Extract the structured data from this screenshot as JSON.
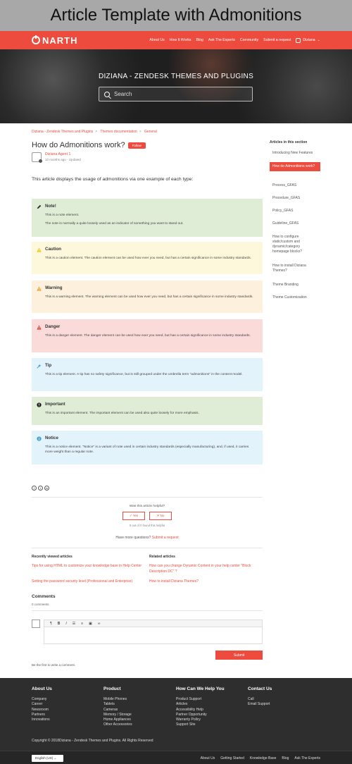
{
  "caption": "Article Template with Admonitions",
  "header": {
    "logo_text": "NARTH",
    "nav": [
      "About Us",
      "How It Works",
      "Blog",
      "Ask The Experts",
      "Community",
      "Submit a request"
    ],
    "user": "Diziana"
  },
  "hero": {
    "title": "DIZIANA - ZENDESK THEMES AND PLUGINS",
    "search_placeholder": "Search"
  },
  "breadcrumbs": [
    "Diziana - Zendesk Themes and Plugins",
    "Themes documentation",
    "General"
  ],
  "article": {
    "title": "How do Admonitions work?",
    "follow_label": "Follow",
    "author": "Diziana Agent 1",
    "meta_time": "10 months ago",
    "meta_sep": "·",
    "meta_status": "Updated",
    "intro": "This article displays the usage of admonitions via one example of each type:"
  },
  "admonitions": [
    {
      "title": "Note!",
      "p1": "This is a note element.",
      "p2": "The note is normally a quite loosely used as an indicator of something you want to stand out.",
      "color": "#dfecd6",
      "icon": "pencil-icon"
    },
    {
      "title": "Caution",
      "p1": "This is a caution element. The caution element can be used how ever you need, but has a certain significance in some industry standards.",
      "color": "#fdf8dc",
      "icon": "caution-icon"
    },
    {
      "title": "Warning",
      "p1": "This is a warning element. The warning element can be used how ever you need, but has a certain significance in some industry standards.",
      "color": "#fdf0dc",
      "icon": "warning-icon"
    },
    {
      "title": "Danger",
      "p1": "This is a danger element. The danger element can be used how ever you need, but has a certain significance in some industry standards.",
      "color": "#fbdada",
      "icon": "danger-icon"
    },
    {
      "title": "Tip",
      "p1": "This is a tip element. A tip has no safety significance, but is still grouped under the umbrella term \"admonitions\" in the content model.",
      "color": "#e3f3fb",
      "icon": "tip-icon"
    },
    {
      "title": "Important",
      "p1": "This is an important element. The important element can be used also quite loosely for more emphasis.",
      "color": "#dfecd6",
      "icon": "important-icon"
    },
    {
      "title": "Notice",
      "p1": "This is a notice element. \"Notice\" is a variant of note used in certain industry standards (especially manufacturing), and, if used, it carries more weight than a regular note.",
      "color": "#e3f3fb",
      "icon": "info-icon"
    }
  ],
  "feedback": {
    "question": "Was this article helpful?",
    "yes": "✓ Yes",
    "no": "✕ No",
    "found": "0 out of 0 found this helpful",
    "more_q": "Have more questions?",
    "submit_request": "Submit a request"
  },
  "recent": {
    "heading": "Recently viewed articles",
    "items": [
      "Tips for using HTML to customize your knowledge base in Help Center",
      "Setting the password security level (Professional and Enterprise)"
    ]
  },
  "related": {
    "heading": "Related articles",
    "items": [
      "How can you change Dynamic Content in your help center \"Block Description DC\" ?",
      "How to install Diziana Themes?"
    ]
  },
  "comments": {
    "heading": "Comments",
    "count": "0 comments",
    "submit": "Submit",
    "first": "Be the first to write a comment."
  },
  "sidebar": {
    "heading": "Articles in this section",
    "items": [
      "Introducing New Features",
      "How do Admonitions work?",
      "Process_GFAS",
      "Procedure_GFAS",
      "Policy_GFAS",
      "Guideline_GFAS",
      "How to configure static/custom and dynamic/category homepage blocks?",
      "How to install Diziana Themes?",
      "Theme Branding",
      "Theme Customization"
    ]
  },
  "footer": {
    "about": {
      "heading": "About Us",
      "links": [
        "Company",
        "Career",
        "Newsroom",
        "Partners",
        "Innovations"
      ]
    },
    "product": {
      "heading": "Product",
      "links": [
        "Mobile Phones",
        "Tablets",
        "Cameras",
        "Memory / Storage",
        "Home Appliances",
        "Other Accessories"
      ]
    },
    "help": {
      "heading": "How Can We Help You",
      "links": [
        "Product Support",
        "Articles",
        "Accessibility Help",
        "Partner Opportunity",
        "Warranty Policy",
        "Support Site"
      ]
    },
    "contact": {
      "heading": "Contact Us",
      "links": [
        "Call",
        "Email Support"
      ]
    },
    "copyright": "Copyright © 2018Diziana - Zendesk Themes and Plugins. All Rights Reserved",
    "language": "English (US)",
    "bottom_links": [
      "About Us",
      "Getting Started",
      "Knowledge Base",
      "Blog",
      "Ask The Experts"
    ]
  },
  "colors": {
    "accent": "#ee4b3f",
    "footer_bg": "#2e2e2e"
  }
}
